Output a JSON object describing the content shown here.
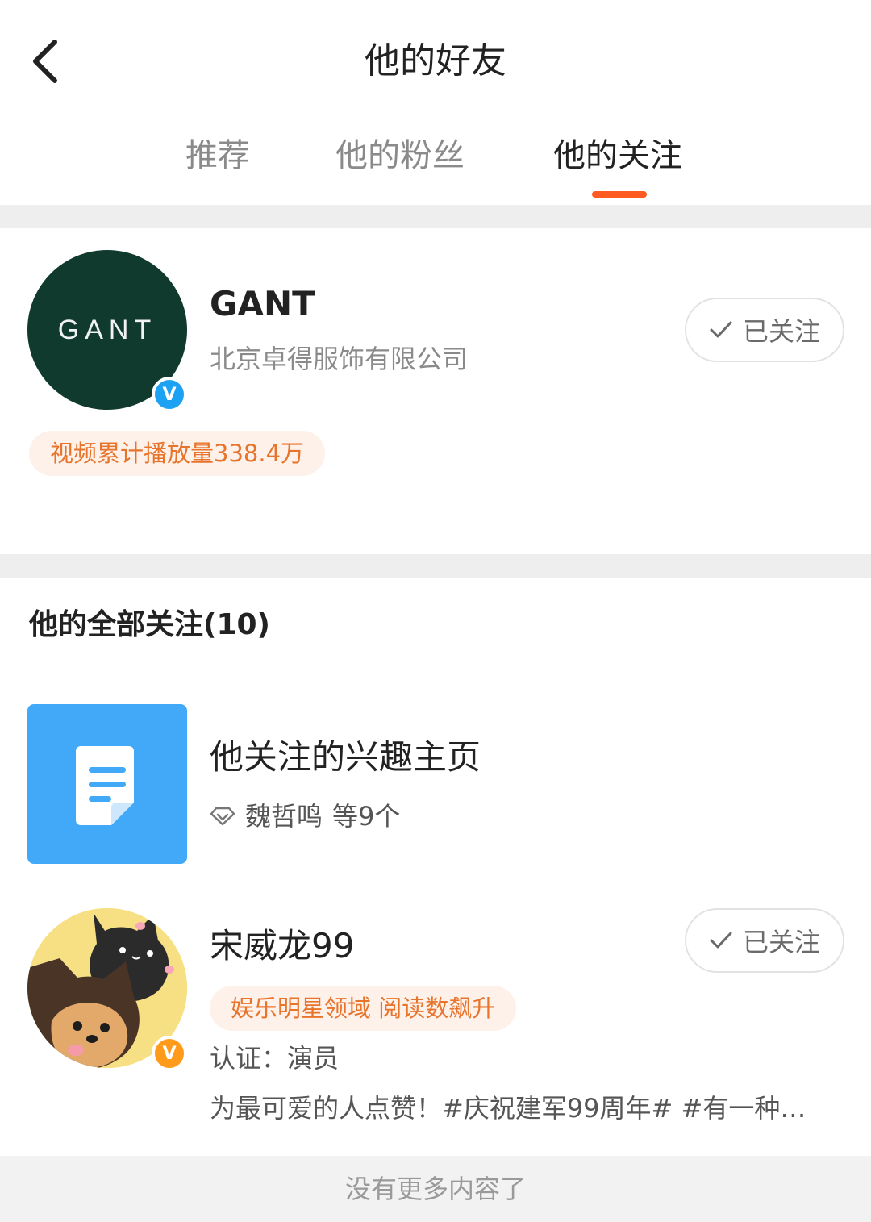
{
  "nav": {
    "title": "他的好友",
    "back_icon": "chevron-left-icon"
  },
  "tabs": [
    {
      "label": "推荐",
      "active": false
    },
    {
      "label": "他的粉丝",
      "active": false
    },
    {
      "label": "他的关注",
      "active": true
    }
  ],
  "colors": {
    "accent": "#ff5a1f",
    "verified_blue": "#1da1f2",
    "verified_orange": "#ff9a1a",
    "tag_text": "#e8742c",
    "tag_bg": "#fdf1ea",
    "interest_tile": "#42a8f8"
  },
  "featured": {
    "name": "GANT",
    "avatar_text": "GANT",
    "description": "北京卓得服饰有限公司",
    "follow_label": "已关注",
    "tag": "视频累计播放量338.4万"
  },
  "following": {
    "title": "他的全部关注(10)",
    "interest_page": {
      "title": "他关注的兴趣主页",
      "meta_name": "魏哲鸣",
      "meta_suffix": "等9个",
      "icon": "document-icon"
    },
    "users": [
      {
        "name": "宋威龙99",
        "tag": "娱乐明星领域 阅读数飙升",
        "certification": "认证：演员",
        "bio": "为最可爱的人点赞！#庆祝建军99周年# #有一种…",
        "follow_label": "已关注"
      }
    ]
  },
  "footer": {
    "text": "没有更多内容了"
  }
}
